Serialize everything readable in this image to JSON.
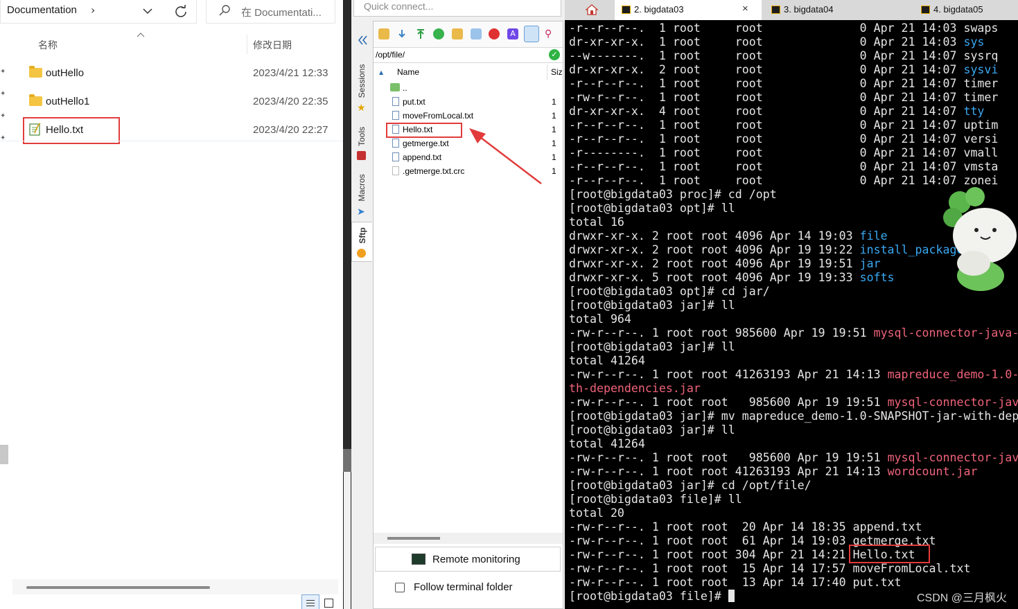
{
  "explorer": {
    "breadcrumb": "Documentation",
    "breadcrumb_chevron": "›",
    "search_placeholder": "在 Documentati...",
    "col_name": "名称",
    "col_date": "修改日期",
    "rows": [
      {
        "name": "outHello",
        "date": "2023/4/21 12:33",
        "type": "folder"
      },
      {
        "name": "outHello1",
        "date": "2023/4/20 22:35",
        "type": "folder"
      },
      {
        "name": "Hello.txt",
        "date": "2023/4/20 22:27",
        "type": "file"
      }
    ],
    "icons": [
      "chevron-down-icon",
      "refresh-icon",
      "search-icon",
      "sort-up-icon",
      "pin-icon",
      "details-view-icon",
      "tiles-view-icon"
    ]
  },
  "moba": {
    "quick_connect": "Quick connect...",
    "side_tabs": [
      "Sessions",
      "Tools",
      "Macros",
      "Sftp"
    ],
    "path": "/opt/file/",
    "col_name": "Name",
    "col_size": "Siz",
    "parent_dir": "..",
    "files": [
      {
        "name": "put.txt",
        "size": "1"
      },
      {
        "name": "moveFromLocal.txt",
        "size": "1"
      },
      {
        "name": "Hello.txt",
        "size": "1"
      },
      {
        "name": "getmerge.txt",
        "size": "1"
      },
      {
        "name": "append.txt",
        "size": "1"
      },
      {
        "name": ".getmerge.txt.crc",
        "size": "1"
      }
    ],
    "remote_monitoring": "Remote monitoring",
    "follow_terminal": "Follow terminal folder",
    "follow_checked": false
  },
  "terminal": {
    "tabs": [
      {
        "label": "2. bigdata03",
        "active": true
      },
      {
        "label": "3. bigdata04",
        "active": false
      },
      {
        "label": "4. bigdata05",
        "active": false
      }
    ],
    "tab_close": "×",
    "lines": [
      {
        "t": "-r--r--r--.  1 root     root              0 Apr 21 14:03 ",
        "c": "swaps",
        "k": ""
      },
      {
        "t": "dr-xr-xr-x.  1 root     root              0 Apr 21 14:03 ",
        "c": "sys",
        "k": "blue"
      },
      {
        "t": "--w-------.  1 root     root              0 Apr 21 14:07 ",
        "c": "sysrq",
        "k": ""
      },
      {
        "t": "dr-xr-xr-x.  2 root     root              0 Apr 21 14:07 ",
        "c": "sysvi",
        "k": "blue"
      },
      {
        "t": "-r--r--r--.  1 root     root              0 Apr 21 14:07 ",
        "c": "timer",
        "k": ""
      },
      {
        "t": "-rw-r--r--.  1 root     root              0 Apr 21 14:07 ",
        "c": "timer",
        "k": ""
      },
      {
        "t": "dr-xr-xr-x.  4 root     root              0 Apr 21 14:07 ",
        "c": "tty",
        "k": "blue"
      },
      {
        "t": "-r--r--r--.  1 root     root              0 Apr 21 14:07 ",
        "c": "uptim",
        "k": ""
      },
      {
        "t": "-r--r--r--.  1 root     root              0 Apr 21 14:07 ",
        "c": "versi",
        "k": ""
      },
      {
        "t": "-r--------.  1 root     root              0 Apr 21 14:07 ",
        "c": "vmall",
        "k": ""
      },
      {
        "t": "-r--r--r--.  1 root     root              0 Apr 21 14:07 ",
        "c": "vmsta",
        "k": ""
      },
      {
        "t": "-r--r--r--.  1 root     root              0 Apr 21 14:07 ",
        "c": "zonei",
        "k": ""
      },
      {
        "t": "[root@bigdata03 proc]# cd /opt",
        "c": "",
        "k": ""
      },
      {
        "t": "[root@bigdata03 opt]# ll",
        "c": "",
        "k": ""
      },
      {
        "t": "total 16",
        "c": "",
        "k": ""
      },
      {
        "t": "drwxr-xr-x. 2 root root 4096 Apr 14 19:03 ",
        "c": "file",
        "k": "blue"
      },
      {
        "t": "drwxr-xr-x. 2 root root 4096 Apr 19 19:22 ",
        "c": "install_package",
        "k": "blue"
      },
      {
        "t": "drwxr-xr-x. 2 root root 4096 Apr 19 19:51 ",
        "c": "jar",
        "k": "blue"
      },
      {
        "t": "drwxr-xr-x. 5 root root 4096 Apr 19 19:33 ",
        "c": "softs",
        "k": "blue"
      },
      {
        "t": "[root@bigdata03 opt]# cd jar/",
        "c": "",
        "k": ""
      },
      {
        "t": "[root@bigdata03 jar]# ll",
        "c": "",
        "k": ""
      },
      {
        "t": "total 964",
        "c": "",
        "k": ""
      },
      {
        "t": "-rw-r--r--. 1 root root 985600 Apr 19 19:51 ",
        "c": "mysql-connector-java-",
        "k": "pink"
      },
      {
        "t": "[root@bigdata03 jar]# ll",
        "c": "",
        "k": ""
      },
      {
        "t": "total 41264",
        "c": "",
        "k": ""
      },
      {
        "t": "-rw-r--r--. 1 root root 41263193 Apr 21 14:13 ",
        "c": "mapreduce_demo-1.0-",
        "k": "pink"
      },
      {
        "t": "",
        "c": "th-dependencies.jar",
        "k": "pink"
      },
      {
        "t": "-rw-r--r--. 1 root root   985600 Apr 19 19:51 ",
        "c": "mysql-connector-jav",
        "k": "pink"
      },
      {
        "t": "[root@bigdata03 jar]# mv mapreduce_demo-1.0-SNAPSHOT-jar-with-dep",
        "c": "",
        "k": ""
      },
      {
        "t": "[root@bigdata03 jar]# ll",
        "c": "",
        "k": ""
      },
      {
        "t": "total 41264",
        "c": "",
        "k": ""
      },
      {
        "t": "-rw-r--r--. 1 root root   985600 Apr 19 19:51 ",
        "c": "mysql-connector-jav",
        "k": "pink"
      },
      {
        "t": "-rw-r--r--. 1 root root 41263193 Apr 21 14:13 ",
        "c": "wordcount.jar",
        "k": "pink"
      },
      {
        "t": "[root@bigdata03 jar]# cd /opt/file/",
        "c": "",
        "k": ""
      },
      {
        "t": "[root@bigdata03 file]# ll",
        "c": "",
        "k": ""
      },
      {
        "t": "total 20",
        "c": "",
        "k": ""
      },
      {
        "t": "-rw-r--r--. 1 root root  20 Apr 14 18:35 append.txt",
        "c": "",
        "k": ""
      },
      {
        "t": "-rw-r--r--. 1 root root  61 Apr 14 19:03 getmerge.txt",
        "c": "",
        "k": ""
      },
      {
        "t": "-rw-r--r--. 1 root root 304 Apr 21 14:21 Hello.txt",
        "c": "",
        "k": ""
      },
      {
        "t": "-rw-r--r--. 1 root root  15 Apr 14 17:57 moveFromLocal.txt",
        "c": "",
        "k": ""
      },
      {
        "t": "-rw-r--r--. 1 root root  13 Apr 14 17:40 put.txt",
        "c": "",
        "k": ""
      },
      {
        "t": "[root@bigdata03 file]# ",
        "c": "",
        "k": ""
      }
    ],
    "watermark": "CSDN @三月枫火"
  }
}
